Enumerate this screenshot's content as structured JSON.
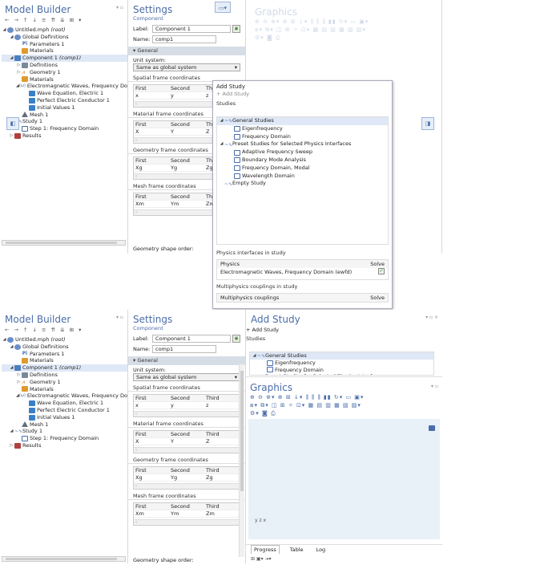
{
  "model_builder": {
    "title": "Model Builder",
    "toolbar": "← → ↑ ↓ ≡ ⇈ ⇊ ⊞ ▾",
    "tree": [
      {
        "label": "Untitled.mph",
        "suffix": "(root)",
        "depth": 0,
        "icon": "g",
        "twisty": "◢"
      },
      {
        "label": "Global Definitions",
        "depth": 1,
        "icon": "g",
        "twisty": "◢"
      },
      {
        "label": "Parameters 1",
        "depth": 2,
        "icon": "p",
        "glyph": "Pi"
      },
      {
        "label": "Materials",
        "depth": 2,
        "icon": "m"
      },
      {
        "label": "Component 1",
        "suffix": "(comp1)",
        "depth": 1,
        "icon": "c",
        "twisty": "◢",
        "highlight": true
      },
      {
        "label": "Definitions",
        "depth": 2,
        "icon": "d",
        "twisty": "▷"
      },
      {
        "label": "Geometry 1",
        "depth": 2,
        "icon": "ge",
        "glyph": "⩘",
        "twisty": "▷"
      },
      {
        "label": "Materials",
        "depth": 2,
        "icon": "m"
      },
      {
        "label": "Electromagnetic Waves, Frequency Domain",
        "depth": 2,
        "icon": "ew",
        "glyph": "(ω)",
        "twisty": "◢"
      },
      {
        "label": "Wave Equation, Electric 1",
        "depth": 3,
        "icon": "f"
      },
      {
        "label": "Perfect Electric Conductor 1",
        "depth": 3,
        "icon": "f"
      },
      {
        "label": "Initial Values 1",
        "depth": 3,
        "icon": "f"
      },
      {
        "label": "Mesh 1",
        "depth": 2,
        "icon": "mesh"
      },
      {
        "label": "Study 1",
        "depth": 1,
        "icon": "study",
        "glyph": "~∿",
        "twisty": "◢"
      },
      {
        "label": "Step 1: Frequency Domain",
        "depth": 2,
        "icon": "step"
      },
      {
        "label": "Results",
        "depth": 1,
        "icon": "res",
        "twisty": "▷"
      }
    ]
  },
  "settings": {
    "title": "Settings",
    "subtitle": "Component",
    "label_caption": "Label:",
    "label_value": "Component 1",
    "name_caption": "Name:",
    "name_value": "comp1",
    "section": "General",
    "unit_caption": "Unit system:",
    "unit_value": "Same as global system",
    "groups": [
      {
        "title": "Spatial frame coordinates",
        "headers": [
          "First",
          "Second",
          "Third"
        ],
        "values": [
          "x",
          "y",
          "z"
        ]
      },
      {
        "title": "Material frame coordinates",
        "headers": [
          "First",
          "Second",
          "Third"
        ],
        "values": [
          "X",
          "Y",
          "Z"
        ]
      },
      {
        "title": "Geometry frame coordinates",
        "headers": [
          "First",
          "Second",
          "Third"
        ],
        "values": [
          "Xg",
          "Yg",
          "Zg"
        ]
      },
      {
        "title": "Mesh frame coordinates",
        "headers": [
          "First",
          "Second",
          "Third"
        ],
        "values": [
          "Xm",
          "Ym",
          "Zm"
        ]
      }
    ],
    "shape_order": "Geometry shape order:"
  },
  "add_study": {
    "title": "Add Study",
    "add_button": "Add Study",
    "studies_caption": "Studies",
    "tree": [
      {
        "label": "General Studies",
        "depth": 0,
        "twisty": "◢",
        "highlight": true
      },
      {
        "label": "Eigenfrequency",
        "depth": 1
      },
      {
        "label": "Frequency Domain",
        "depth": 1
      },
      {
        "label": "Preset Studies for Selected Physics Interfaces",
        "depth": 0,
        "twisty": "◢"
      },
      {
        "label": "Adaptive Frequency Sweep",
        "depth": 1
      },
      {
        "label": "Boundary Mode Analysis",
        "depth": 1
      },
      {
        "label": "Frequency Domain, Modal",
        "depth": 1
      },
      {
        "label": "Wavelength Domain",
        "depth": 1
      },
      {
        "label": "Empty Study",
        "depth": 0
      }
    ],
    "physics_caption": "Physics interfaces in study",
    "physics_header": "Physics",
    "solve_header": "Solve",
    "physics_row": "Electromagnetic Waves, Frequency Domain (ewfd)",
    "multi_caption": "Multiphysics couplings in study",
    "multi_header": "Multiphysics couplings",
    "multi_solve": "Solve"
  },
  "graphics": {
    "title": "Graphics",
    "toolbar1": "⊕ ⊖ ⊕▾ ⊕ ⊞ ↓▾ ⫼ ⫼ ⫼ ▮▮ ↻▾ ▭ ▣▾",
    "toolbar2": "⧈▾ ⧉▾ ◫ ⊞ ✧ ⊡▾ ▦ ▤ ▥ ▦ ▧ ▨▾",
    "toolbar3": "⚙▾ ◙ ⎙",
    "triad": "y z x"
  },
  "bottom_tabs": [
    "Progress",
    "Table",
    "Log"
  ],
  "bottom_toolbar": "⊞ ▣▾ ⇥▾"
}
